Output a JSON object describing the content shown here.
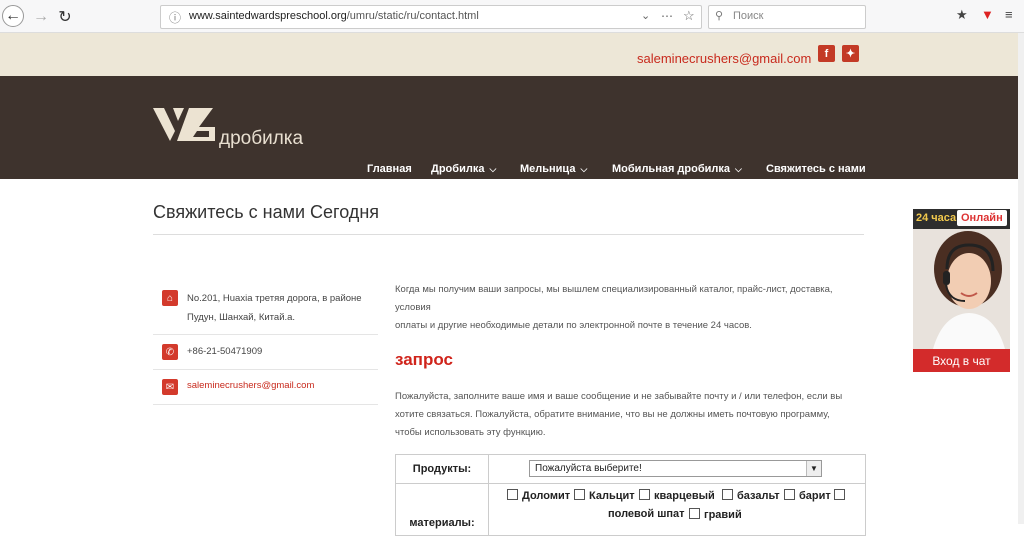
{
  "browser": {
    "url_domain": "www.saintedwardspreschool.org",
    "url_path": "/umru/static/ru/contact.html",
    "search_placeholder": "Поиск"
  },
  "topbar": {
    "email": "saleminecrushers@gmail.com"
  },
  "header": {
    "logo_text": "дробилка",
    "menu": [
      "Главная",
      "Дробилка",
      "Мельница",
      "Мобильная дробилка",
      "Свяжитесь с нами"
    ]
  },
  "page": {
    "title": "Свяжитесь с нами Сегодня"
  },
  "contact": {
    "address_line1": "No.201, Huaxia третяя дорога, в районе",
    "address_line2": "Пудун, Шанхай, Китай.а.",
    "phone": "+86-21-50471909",
    "email": "saleminecrushers@gmail.com"
  },
  "intro": {
    "line1": "Когда мы получим ваши запросы, мы вышлем специализированный каталог, прайс-лист, доставка, условия",
    "line2": "оплаты и другие необходимые детали по электронной почте в течение 24 часов."
  },
  "inquiry": {
    "heading": "запрос",
    "line1": "Пожалуйста, заполните ваше имя и ваше сообщение и не забывайте почту и / или телефон, если вы",
    "line2": "хотите связаться. Пожалуйста, обратите внимание, что вы не должны иметь почтовую программу,",
    "line3": "чтобы использовать эту функцию."
  },
  "form": {
    "products_label": "Продукты:",
    "products_select": "Пожалуйста выберите!",
    "materials_label": "материалы:",
    "materials": [
      "Доломит",
      "Кальцит",
      "кварцевый",
      "базальт",
      "барит",
      "полевой шпат",
      "гравий"
    ]
  },
  "chat": {
    "hours": "24 часа",
    "online": "Онлайн",
    "button": "Вход в чат"
  }
}
